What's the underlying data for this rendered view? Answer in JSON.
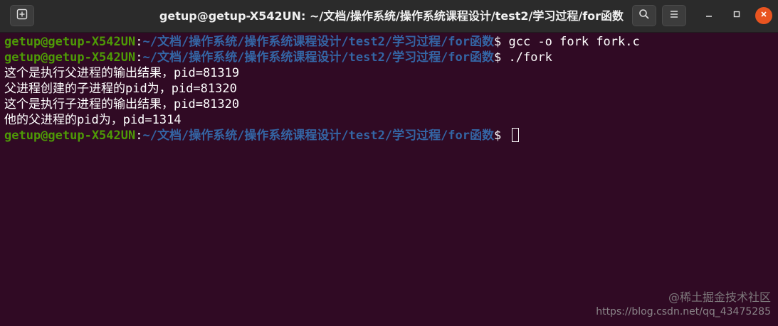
{
  "window": {
    "title": "getup@getup-X542UN: ~/文档/操作系统/操作系统课程设计/test2/学习过程/for函数",
    "new_tab_icon": "new-tab-icon",
    "search_icon": "search-icon",
    "menu_icon": "hamburger-menu-icon",
    "minimize_icon": "minimize-icon",
    "maximize_icon": "maximize-icon",
    "close_icon": "close-icon"
  },
  "colors": {
    "background": "#300a24",
    "titlebar": "#2b2b2b",
    "prompt_user": "#4e9a06",
    "prompt_path": "#3465a4",
    "close_button": "#e95420"
  },
  "terminal": {
    "prompt_user": "getup@getup-X542UN",
    "prompt_sep": ":",
    "prompt_path": "~/文档/操作系统/操作系统课程设计/test2/学习过程/for函数",
    "prompt_symbol": "$ ",
    "commands": [
      "gcc -o fork fork.c",
      "./fork"
    ],
    "output": [
      "这个是执行父进程的输出结果，pid=81319",
      "父进程创建的子进程的pid为，pid=81320",
      "这个是执行子进程的输出结果，pid=81320",
      "他的父进程的pid为，pid=1314"
    ]
  },
  "watermark": {
    "line1": "@稀土掘金技术社区",
    "line2": "https://blog.csdn.net/qq_43475285"
  }
}
